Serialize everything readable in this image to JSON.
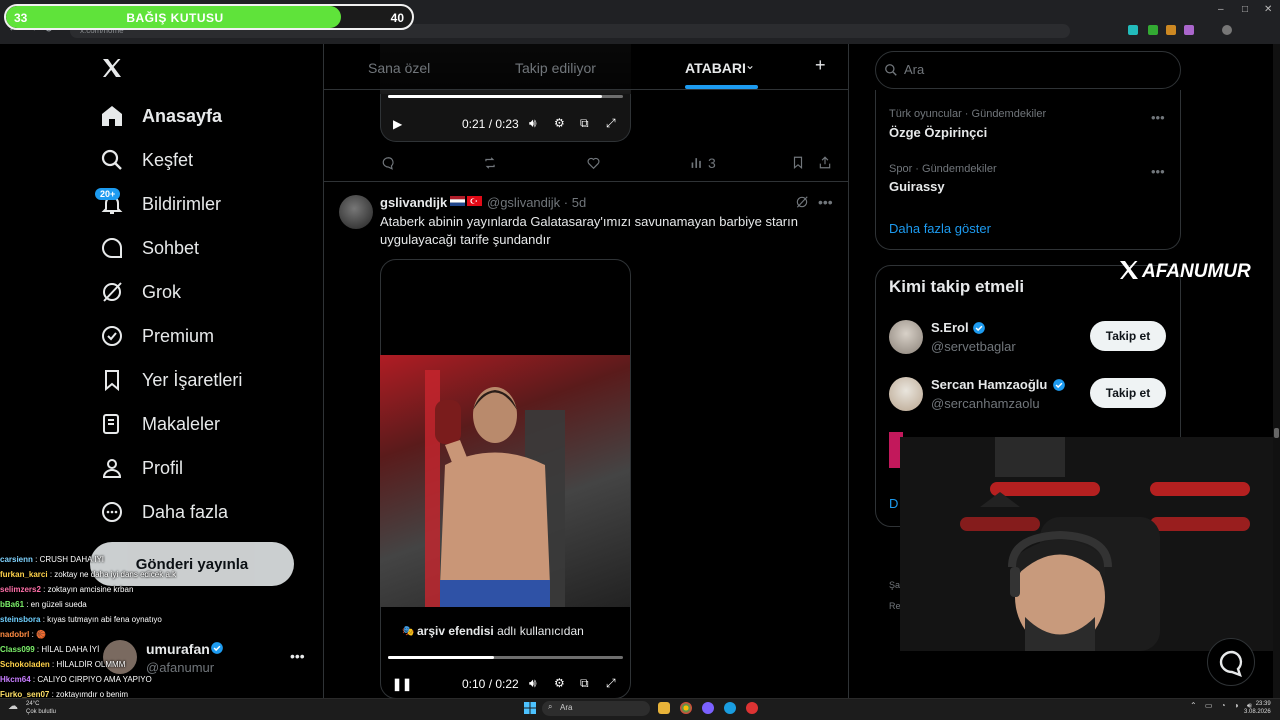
{
  "donation": {
    "min": "33",
    "title": "BAĞIŞ KUTUSU",
    "max": "40",
    "progress": 0.825
  },
  "browser": {
    "url": "x.com/home"
  },
  "nav": {
    "items": [
      {
        "label": "Anasayfa",
        "icon": "home-icon"
      },
      {
        "label": "Keşfet",
        "icon": "search-icon"
      },
      {
        "label": "Bildirimler",
        "icon": "bell-icon"
      },
      {
        "label": "Sohbet",
        "icon": "chat-icon"
      },
      {
        "label": "Grok",
        "icon": "grok-icon"
      },
      {
        "label": "Premium",
        "icon": "premium-badge-icon"
      },
      {
        "label": "Yer İşaretleri",
        "icon": "bookmark-icon"
      },
      {
        "label": "Makaleler",
        "icon": "article-icon"
      },
      {
        "label": "Profil",
        "icon": "person-icon"
      },
      {
        "label": "Daha fazla",
        "icon": "more-circle-icon"
      }
    ],
    "notif_badge": "20+",
    "post_button": "Gönderi yayınla"
  },
  "account": {
    "name": "umurafan",
    "handle": "@afanumur"
  },
  "chat": [
    {
      "user": "carsienn",
      "color": "#7fd3ff",
      "msg": "CRUSH DAHA IYI"
    },
    {
      "user": "furkan_karci",
      "color": "#ffd24a",
      "msg": "zoktay ne daha iyi dans edicek a.k"
    },
    {
      "user": "selimzers2",
      "color": "#ff6fa8",
      "msg": "zoktayın amcisine krban"
    },
    {
      "user": "bBa61",
      "color": "#7cf06a",
      "msg": "en güzeli sueda"
    },
    {
      "user": "steinsbora",
      "color": "#6fd0ff",
      "msg": "kıyas tutmayın abi fena oynatıyo"
    },
    {
      "user": "nadobrl",
      "color": "#ff8c42",
      "msg": "🏀"
    },
    {
      "user": "Class099",
      "color": "#7cf06a",
      "msg": "HİLAL DAHA İYİ"
    },
    {
      "user": "Schokoladen",
      "color": "#ffd24a",
      "msg": "HİLALDİR OLMMM"
    },
    {
      "user": "Hkcm64",
      "color": "#c77dff",
      "msg": "CALIYO CIRPIYO AMA YAPIYO"
    },
    {
      "user": "Furko_sen07",
      "color": "#ffe066",
      "msg": "zoktayımdır o benim"
    }
  ],
  "tabs": {
    "for_you": "Sana özel",
    "following": "Takip ediliyor",
    "active": "ATABARI"
  },
  "tweet1": {
    "video_time": "0:21 / 0:23",
    "video_progress": 0.91,
    "views": "3"
  },
  "tweet2": {
    "name": "gslivandijk",
    "handle": "@gslivandijk",
    "age": "· 5d",
    "text": "Ataberk abinin yayınlarda Galatasaray'ımızı savunamayan barbiye starın uygulayacağı tarife şundandır",
    "caption_user": "arşiv efendisi",
    "caption_rest": "adlı kullanıcıdan",
    "video_time": "0:10 / 0:22",
    "video_progress": 0.45
  },
  "search": {
    "placeholder": "Ara"
  },
  "trends": [
    {
      "meta": "Türk oyuncular · Gündemdekiler",
      "name": "Özge Özpirinçci"
    },
    {
      "meta": "Spor · Gündemdekiler",
      "name": "Guirassy"
    }
  ],
  "show_more": "Daha fazla göster",
  "who_to_follow": {
    "title": "Kimi takip etmeli",
    "users": [
      {
        "name": "S.Erol",
        "handle": "@servetbaglar",
        "button": "Takip et"
      },
      {
        "name": "Sercan Hamzaoğlu",
        "handle": "@sercanhamzaolu",
        "button": "Takip et"
      }
    ],
    "partial_link": "D"
  },
  "footer": {
    "line1": "Şa",
    "line2": "Re"
  },
  "watermark": "AFANUMUR",
  "taskbar": {
    "weather_temp": "24°C",
    "weather_text": "Çok bulutlu",
    "search": "Ara",
    "time": "23:39",
    "date": "3.08.2026"
  },
  "colors": {
    "accent": "#1d9bf0",
    "donation_green": "#5fe33a"
  }
}
